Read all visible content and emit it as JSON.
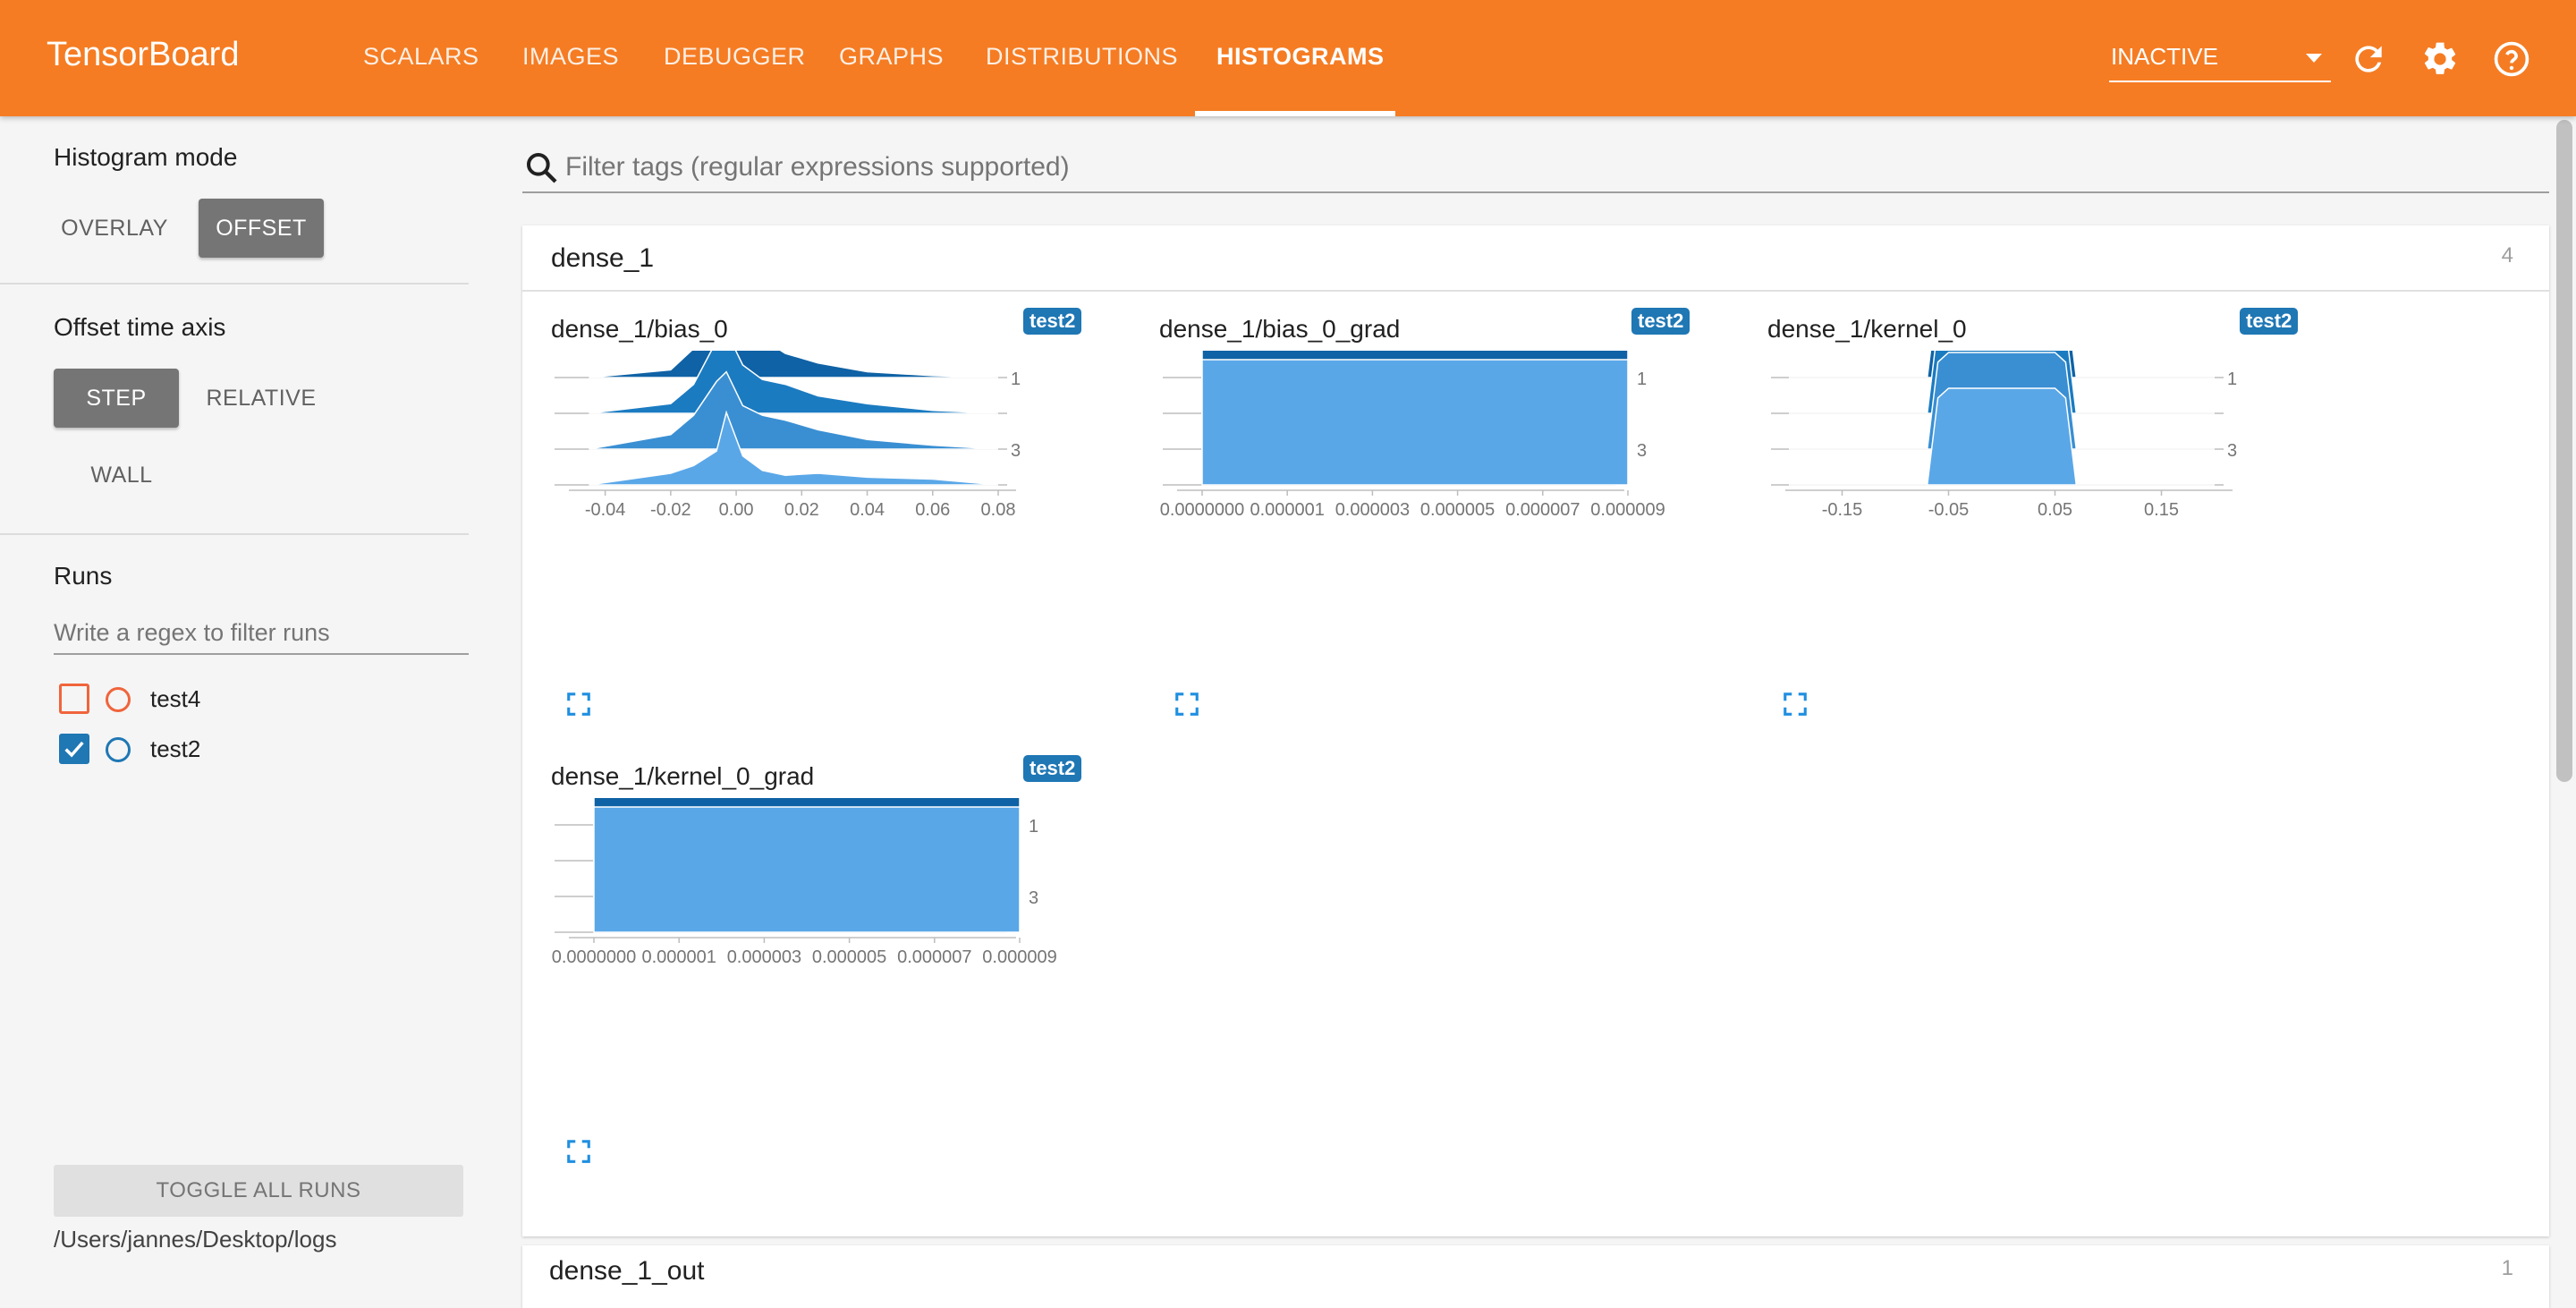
{
  "header": {
    "brand": "TensorBoard",
    "tabs": [
      "SCALARS",
      "IMAGES",
      "DEBUGGER",
      "GRAPHS",
      "DISTRIBUTIONS",
      "HISTOGRAMS"
    ],
    "active_tab": "HISTOGRAMS",
    "run_status": "INACTIVE",
    "icons": [
      "refresh-icon",
      "settings-gear-icon",
      "help-icon"
    ]
  },
  "sidebar": {
    "histogram_mode_label": "Histogram mode",
    "mode_overlay": "OVERLAY",
    "mode_offset": "OFFSET",
    "selected_mode": "OFFSET",
    "offset_axis_label": "Offset time axis",
    "axis_step": "STEP",
    "axis_relative": "RELATIVE",
    "axis_wall": "WALL",
    "selected_axis": "STEP",
    "runs_label": "Runs",
    "runs_filter_placeholder": "Write a regex to filter runs",
    "runs": [
      {
        "name": "test4",
        "checked": false,
        "color": "#f0643c"
      },
      {
        "name": "test2",
        "checked": true,
        "color": "#1f77b4"
      }
    ],
    "toggle_all_label": "TOGGLE ALL RUNS",
    "log_dir": "/Users/jannes/Desktop/logs"
  },
  "main": {
    "search_placeholder": "Filter tags (regular expressions supported)",
    "section": {
      "title": "dense_1",
      "count": "4"
    },
    "next_section": {
      "title": "dense_1_out",
      "count": "1"
    },
    "cards": [
      {
        "title": "dense_1/bias_0",
        "run": "test2"
      },
      {
        "title": "dense_1/bias_0_grad",
        "run": "test2"
      },
      {
        "title": "dense_1/kernel_0",
        "run": "test2"
      },
      {
        "title": "dense_1/kernel_0_grad",
        "run": "test2"
      }
    ]
  },
  "chart_data": [
    {
      "type": "area",
      "title": "dense_1/bias_0",
      "x_ticks": [
        "-0.04",
        "-0.02",
        "0.00",
        "0.02",
        "0.04",
        "0.06",
        "0.08"
      ],
      "xlim": [
        -0.05,
        0.08
      ],
      "step_ticks": [
        "1",
        "3"
      ],
      "series": [
        {
          "step": 0,
          "x": [
            -0.045,
            -0.02,
            -0.013,
            -0.006,
            -0.003,
            0.002,
            0.008,
            0.015,
            0.025,
            0.04,
            0.06,
            0.08
          ],
          "y": [
            0,
            0.05,
            0.35,
            0.9,
            1.0,
            0.6,
            0.35,
            0.22,
            0.12,
            0.05,
            0.02,
            0
          ]
        },
        {
          "step": 1,
          "x": [
            -0.045,
            -0.02,
            -0.013,
            -0.006,
            -0.003,
            0.002,
            0.008,
            0.015,
            0.025,
            0.04,
            0.06,
            0.08
          ],
          "y": [
            0,
            0.08,
            0.3,
            0.8,
            0.9,
            0.55,
            0.4,
            0.25,
            0.15,
            0.06,
            0.02,
            0
          ]
        },
        {
          "step": 2,
          "x": [
            -0.045,
            -0.02,
            -0.013,
            -0.006,
            -0.003,
            0.002,
            0.008,
            0.015,
            0.025,
            0.04,
            0.06,
            0.08
          ],
          "y": [
            0,
            0.1,
            0.3,
            0.75,
            0.85,
            0.5,
            0.35,
            0.3,
            0.18,
            0.1,
            0.03,
            0
          ]
        },
        {
          "step": 3,
          "x": [
            -0.045,
            -0.02,
            -0.013,
            -0.006,
            -0.003,
            0.002,
            0.008,
            0.015,
            0.025,
            0.04,
            0.06,
            0.08
          ],
          "y": [
            0,
            0.15,
            0.35,
            0.7,
            0.8,
            0.45,
            0.35,
            0.3,
            0.2,
            0.1,
            0.04,
            0
          ]
        },
        {
          "step": 4,
          "x": [
            -0.045,
            -0.02,
            -0.013,
            -0.006,
            -0.003,
            0.002,
            0.008,
            0.015,
            0.025,
            0.04,
            0.06,
            0.08
          ],
          "y": [
            0,
            0.12,
            0.2,
            0.35,
            0.75,
            0.3,
            0.15,
            0.1,
            0.12,
            0.08,
            0.06,
            0
          ]
        }
      ]
    },
    {
      "type": "area",
      "title": "dense_1/bias_0_grad",
      "x_ticks": [
        "0.0000000",
        "0.000001",
        "0.000003",
        "0.000005",
        "0.000007",
        "0.000009"
      ],
      "step_ticks": [
        "1",
        "3"
      ],
      "series": [
        {
          "step": 0,
          "x": [
            0,
            1
          ],
          "y": [
            1,
            1
          ]
        },
        {
          "step": 1,
          "x": [
            0,
            1
          ],
          "y": [
            1,
            1
          ]
        },
        {
          "step": 2,
          "x": [
            0,
            1
          ],
          "y": [
            1,
            1
          ]
        },
        {
          "step": 3,
          "x": [
            0,
            1
          ],
          "y": [
            1,
            1
          ]
        },
        {
          "step": 4,
          "x": [
            0,
            1
          ],
          "y": [
            1,
            1
          ]
        }
      ]
    },
    {
      "type": "area",
      "title": "dense_1/kernel_0",
      "x_ticks": [
        "-0.15",
        "-0.05",
        "0.05",
        "0.15"
      ],
      "xlim": [
        -0.2,
        0.2
      ],
      "step_ticks": [
        "1",
        "3"
      ],
      "series": [
        {
          "step": 0,
          "x": [
            -0.2,
            -0.07,
            -0.06,
            -0.05,
            0.05,
            0.06,
            0.07,
            0.2
          ],
          "y": [
            0,
            0,
            0.9,
            1,
            1,
            0.9,
            0,
            0
          ]
        },
        {
          "step": 1,
          "x": [
            -0.2,
            -0.07,
            -0.06,
            -0.05,
            0.05,
            0.06,
            0.07,
            0.2
          ],
          "y": [
            0,
            0,
            0.9,
            1,
            1,
            0.9,
            0,
            0
          ]
        },
        {
          "step": 2,
          "x": [
            -0.2,
            -0.07,
            -0.06,
            -0.05,
            0.05,
            0.06,
            0.07,
            0.2
          ],
          "y": [
            0,
            0,
            0.9,
            1,
            1,
            0.9,
            0,
            0
          ]
        },
        {
          "step": 3,
          "x": [
            -0.2,
            -0.07,
            -0.06,
            -0.05,
            0.05,
            0.06,
            0.07,
            0.2
          ],
          "y": [
            0,
            0,
            0.9,
            1,
            1,
            0.9,
            0,
            0
          ]
        },
        {
          "step": 4,
          "x": [
            -0.2,
            -0.07,
            -0.06,
            -0.05,
            0.05,
            0.06,
            0.07,
            0.2
          ],
          "y": [
            0,
            0,
            0.9,
            1,
            1,
            0.9,
            0,
            0
          ]
        }
      ]
    },
    {
      "type": "area",
      "title": "dense_1/kernel_0_grad",
      "x_ticks": [
        "0.0000000",
        "0.000001",
        "0.000003",
        "0.000005",
        "0.000007",
        "0.000009"
      ],
      "step_ticks": [
        "1",
        "3"
      ],
      "series": [
        {
          "step": 0,
          "x": [
            0,
            1
          ],
          "y": [
            1,
            1
          ]
        },
        {
          "step": 1,
          "x": [
            0,
            1
          ],
          "y": [
            1,
            1
          ]
        },
        {
          "step": 2,
          "x": [
            0,
            1
          ],
          "y": [
            1,
            1
          ]
        },
        {
          "step": 3,
          "x": [
            0,
            1
          ],
          "y": [
            1,
            1
          ]
        },
        {
          "step": 4,
          "x": [
            0,
            1
          ],
          "y": [
            1,
            1
          ]
        }
      ]
    }
  ],
  "colors": {
    "accent": "#f57c23",
    "series_shades": [
      "#0b4a87",
      "#0f62a5",
      "#1b7bc1",
      "#3a8fd3",
      "#5aa7e8"
    ]
  }
}
